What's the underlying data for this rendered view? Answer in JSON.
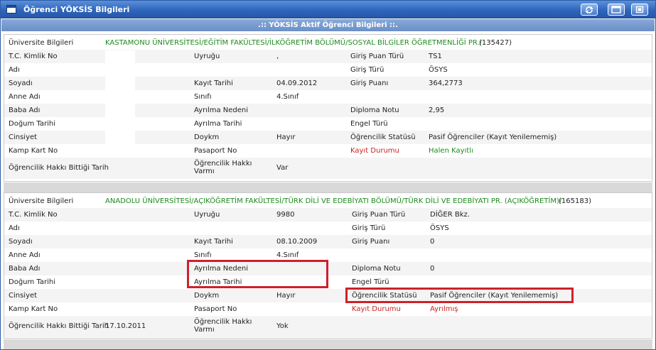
{
  "window": {
    "title": "Öğrenci YÖKSİS Bilgileri",
    "buttons": [
      "refresh-icon",
      "restore-icon",
      "close-icon"
    ]
  },
  "section_header": ".:: YÖKSİS Aktif Öğrenci Bilgileri ::.",
  "labels": {
    "universite": "Üniversite Bilgileri",
    "tc": "T.C. Kimlik No",
    "ad": "Adı",
    "soyad": "Soyadı",
    "anne": "Anne Adı",
    "baba": "Baba Adı",
    "dogum": "Doğum Tarihi",
    "cinsiyet": "Cinsiyet",
    "kamp": "Kamp Kart No",
    "hak_bitti": "Öğrencilik Hakkı Bittiği Tarih",
    "uyruk": "Uyruğu",
    "kayit_tarihi": "Kayıt Tarihi",
    "sinif": "Sınıfı",
    "ayrilma_nedeni": "Ayrılma Nedeni",
    "ayrilma_tarihi": "Ayrılma Tarihi",
    "doykm": "Doykm",
    "pasaport": "Pasaport No",
    "hak_varmi_1": "Öğrencilik Hakkı",
    "hak_varmi_2": "Varmı",
    "giris_puan_turu": "Giriş Puan Türü",
    "giris_turu": "Giriş Türü",
    "giris_puani": "Giriş Puanı",
    "diploma": "Diploma Notu",
    "engel": "Engel Türü",
    "statu": "Öğrencilik Statüsü",
    "kayit_durumu": "Kayıt Durumu"
  },
  "records": [
    {
      "universite": "KASTAMONU ÜNİVERSİTESİ/EĞİTİM FAKÜLTESİ/İLKÖĞRETİM BÖLÜMÜ/SOSYAL BİLGİLER ÖĞRETMENLİĞİ PR./",
      "program_code": "(135427)",
      "uyruk": ",",
      "kayit_tarihi": "04.09.2012",
      "sinif": "4.Sınıf",
      "ayrilma_nedeni": "",
      "ayrilma_tarihi": "",
      "doykm": "Hayır",
      "pasaport": "",
      "hak_varmi": "Var",
      "hak_bitti": "",
      "giris_puan_turu": "TS1",
      "giris_turu": "ÖSYS",
      "giris_puani": "364,2773",
      "diploma": "2,95",
      "engel": "",
      "statu": "Pasif Öğrenciler (Kayıt Yenilememiş)",
      "kayit_durumu": "Halen Kayıtlı"
    },
    {
      "universite": "ANADOLU ÜNİVERSİTESİ/AÇIKÖĞRETİM FAKÜLTESİ/TÜRK DİLİ VE EDEBİYATI BÖLÜMÜ/TÜRK DİLİ VE EDEBİYATI PR. (AÇIKÖĞRETİM)/",
      "program_code": "(165183)",
      "uyruk": "9980",
      "kayit_tarihi": "08.10.2009",
      "sinif": "4.Sınıf",
      "ayrilma_nedeni": "",
      "ayrilma_tarihi": "",
      "doykm": "Hayır",
      "pasaport": "",
      "hak_varmi": "Yok",
      "hak_bitti": "17.10.2011",
      "giris_puan_turu": "DİĞER Bkz.",
      "giris_turu": "ÖSYS",
      "giris_puani": "0",
      "diploma": "0",
      "engel": "",
      "statu": "Pasif Öğrenciler (Kayıt Yenilememiş)",
      "kayit_durumu": "Ayrılmış"
    }
  ],
  "colors": {
    "titlebar": "#2f66bd",
    "section_header": "#7a9cd0",
    "university_text": "#1d8a1d",
    "status_red": "#cc2222",
    "highlight_box": "#d0202a"
  }
}
